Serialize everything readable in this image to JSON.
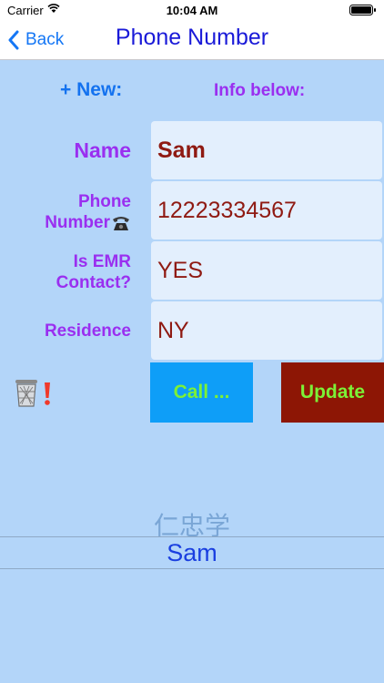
{
  "status_bar": {
    "carrier": "Carrier",
    "time": "10:04 AM",
    "wifi_icon": "wifi-icon",
    "battery_icon": "battery-icon"
  },
  "nav": {
    "back_label": "Back",
    "title": "Phone Number"
  },
  "header": {
    "new_label": "+ New:",
    "info_label": "Info below:"
  },
  "fields": [
    {
      "label": "Name",
      "value": "Sam"
    },
    {
      "label_line1": "Phone",
      "label_line2": "Number",
      "label_icon": "telephone-icon",
      "value": "12223334567"
    },
    {
      "label_line1": "Is EMR",
      "label_line2": "Contact?",
      "value": "YES"
    },
    {
      "label": "Residence",
      "value": "NY"
    }
  ],
  "actions": {
    "delete_icon": "trash-icon",
    "alert_icon": "exclamation-icon",
    "call_label": "Call ...",
    "update_label": "Update"
  },
  "picker": {
    "previous_item": "仁忠学",
    "selected_item": "Sam"
  },
  "colors": {
    "background": "#b3d5f9",
    "accent_blue": "#1577f5",
    "label_purple": "#9a2ff0",
    "value_red": "#8f1a12",
    "call_button": "#0e9ef8",
    "update_button": "#8d1605",
    "button_text": "#7cf137"
  }
}
